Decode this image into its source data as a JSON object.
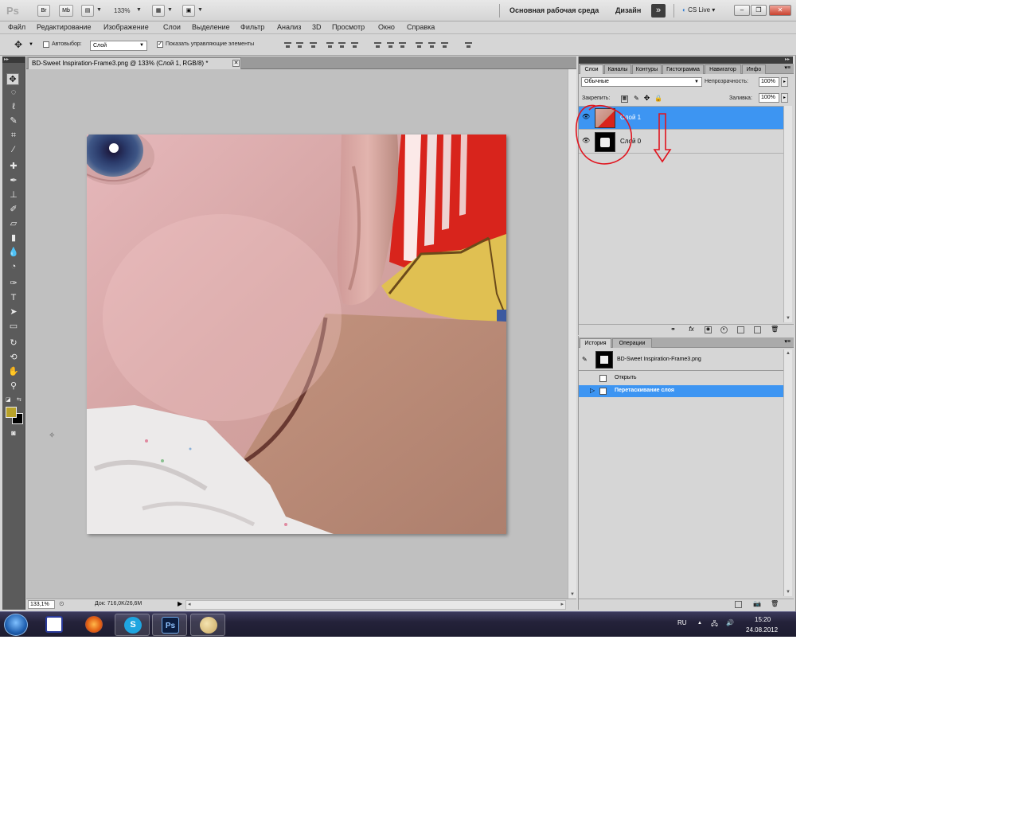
{
  "appbar": {
    "logo": "Ps",
    "br": "Br",
    "mb": "Mb",
    "zoom": "133%",
    "workspace_main": "Основная рабочая среда",
    "workspace_design": "Дизайн",
    "cs_live": "CS Live"
  },
  "menu": [
    "Файл",
    "Редактирование",
    "Изображение",
    "Слои",
    "Выделение",
    "Фильтр",
    "Анализ",
    "3D",
    "Просмотр",
    "Окно",
    "Справка"
  ],
  "options": {
    "autoselect_label": "Автовыбор:",
    "autoselect_value": "Слой",
    "show_controls_label": "Показать управляющие элементы"
  },
  "document": {
    "tab_title": "BD-Sweet Inspiration-Frame3.png @ 133% (Слой 1, RGB/8) *",
    "zoom": "133,1%",
    "doc_info": "Док: 716,0K/26,6M"
  },
  "layers_panel": {
    "tabs": [
      "Слои",
      "Каналы",
      "Контуры",
      "Гистограмма",
      "Навигатор",
      "Инфо"
    ],
    "blend_mode": "Обычные",
    "opacity_label": "Непрозрачность:",
    "opacity_value": "100%",
    "lock_label": "Закрепить:",
    "fill_label": "Заливка:",
    "fill_value": "100%",
    "layers": [
      {
        "name": "Слой 1",
        "selected": true
      },
      {
        "name": "Слой 0",
        "selected": false
      }
    ]
  },
  "history_panel": {
    "tabs": [
      "История",
      "Операции"
    ],
    "snapshot": "BD-Sweet Inspiration-Frame3.png",
    "steps": [
      {
        "label": "Открыть",
        "selected": false
      },
      {
        "label": "Перетаскивание слоя",
        "selected": true
      }
    ]
  },
  "taskbar": {
    "lang": "RU",
    "time": "15:20",
    "date": "24.08.2012",
    "ps_label": "Ps"
  },
  "colors": {
    "selection": "#3d95f2",
    "foreground": "#b8a22a",
    "background": "#000000",
    "annotation": "#e0141e"
  }
}
